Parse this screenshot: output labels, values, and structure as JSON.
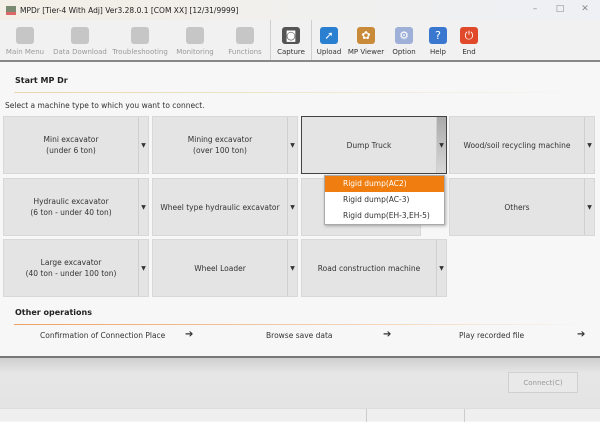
{
  "window": {
    "title": "MPDr [Tier-4 With Adj] Ver3.28.0.1 [COM XX] [12/31/9999]",
    "minimize": "–",
    "maximize": "□",
    "close": "✕"
  },
  "toolbar": [
    {
      "label": "Main Menu",
      "icon": "main-menu-icon",
      "enabled": false
    },
    {
      "label": "Data Download",
      "icon": "download-icon",
      "enabled": false
    },
    {
      "label": "Troubleshooting",
      "icon": "stethoscope-icon",
      "enabled": false
    },
    {
      "label": "Monitoring",
      "icon": "gauge-icon",
      "enabled": false
    },
    {
      "label": "Functions",
      "icon": "functions-icon",
      "enabled": false
    },
    {
      "label": "Capture",
      "icon": "camera-icon",
      "enabled": true
    },
    {
      "label": "Upload",
      "icon": "upload-icon",
      "enabled": true
    },
    {
      "label": "MP Viewer",
      "icon": "viewer-icon",
      "enabled": true
    },
    {
      "label": "Option",
      "icon": "gear-icon",
      "enabled": true
    },
    {
      "label": "Help",
      "icon": "help-icon",
      "enabled": true
    },
    {
      "label": "End",
      "icon": "power-icon",
      "enabled": true
    }
  ],
  "start": {
    "title": "Start MP Dr",
    "instruction": "Select a machine type to which you want to connect."
  },
  "machines": [
    "Mini excavator\n(under 6 ton)",
    "Mining excavator\n(over 100 ton)",
    "Dump Truck",
    "Wood/soil recycling machine",
    "Hydraulic excavator\n(6 ton - under 40 ton)",
    "Wheel type hydraulic excavator",
    "",
    "Others",
    "Large excavator\n(40 ton - under 100 ton)",
    "Wheel Loader",
    "Road construction machine"
  ],
  "dropdown": {
    "items": [
      "Rigid dump(AC2)",
      "Rigid dump(AC-3)",
      "Rigid dump(EH-3,EH-5)"
    ],
    "highlighted": 0
  },
  "other": {
    "title": "Other operations",
    "items": [
      "Confirmation of Connection Place",
      "Browse save data",
      "Play recorded file"
    ],
    "arrow": "➔"
  },
  "footer": {
    "connect": "Connect(C)"
  },
  "colors": {
    "accent": "#ef7d0f"
  }
}
